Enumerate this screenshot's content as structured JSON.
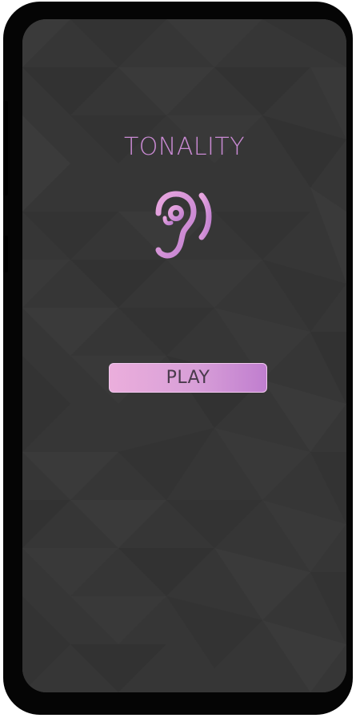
{
  "app": {
    "title": "TONALITY",
    "play_label": "PLAY"
  },
  "icons": {
    "logo": "ear-with-sound-waves-icon"
  },
  "colors": {
    "accent": "#c98ad3",
    "background": "#363636",
    "button_gradient_start": "#ebaedc",
    "button_gradient_end": "#c07ecf",
    "button_text": "#4a3a4c"
  }
}
